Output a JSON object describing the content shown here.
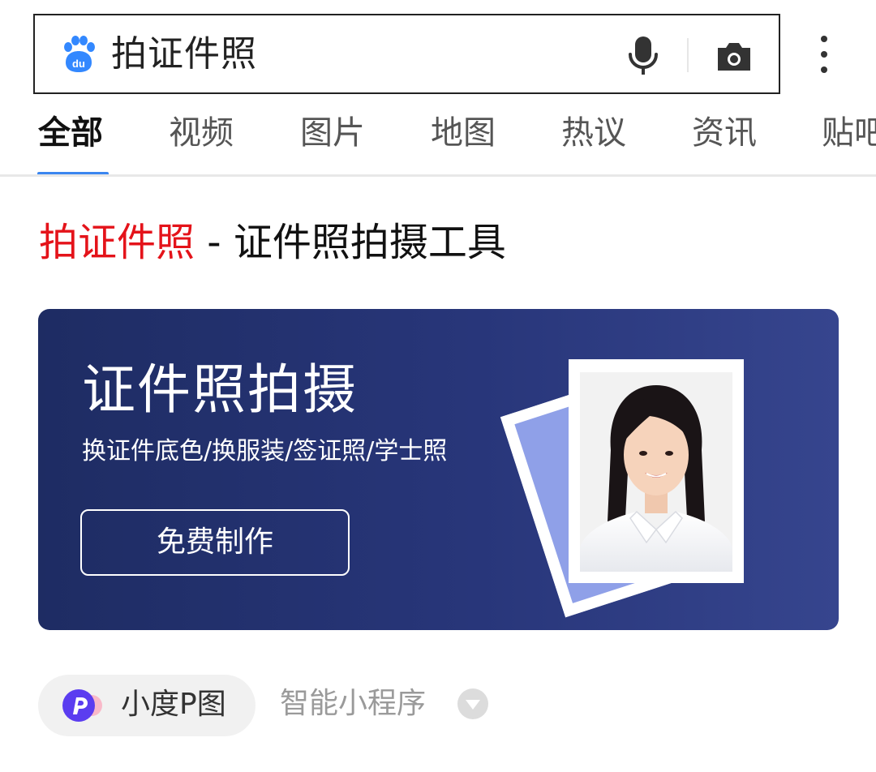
{
  "search": {
    "query": "拍证件照"
  },
  "icons": {
    "logo": "baidu-paw-logo",
    "mic": "microphone-icon",
    "camera": "camera-icon",
    "more": "more-vertical-icon",
    "mini_logo": "xiaodu-p-logo",
    "toggle": "chevron-down-circle-icon"
  },
  "tabs": [
    {
      "label": "全部",
      "active": true
    },
    {
      "label": "视频"
    },
    {
      "label": "图片"
    },
    {
      "label": "地图"
    },
    {
      "label": "热议"
    },
    {
      "label": "资讯"
    },
    {
      "label": "贴吧"
    }
  ],
  "result": {
    "title_highlight": "拍证件照",
    "title_rest": " - 证件照拍摄工具"
  },
  "banner": {
    "title": "证件照拍摄",
    "subtitle": "换证件底色/换服装/签证照/学士照",
    "button": "免费制作"
  },
  "mini_program": {
    "name": "小度P图",
    "type": "智能小程序"
  },
  "colors": {
    "highlight": "#e4131a",
    "accent": "#3b86f0",
    "banner_dark": "#1e2c63",
    "banner_light": "#36458e"
  }
}
